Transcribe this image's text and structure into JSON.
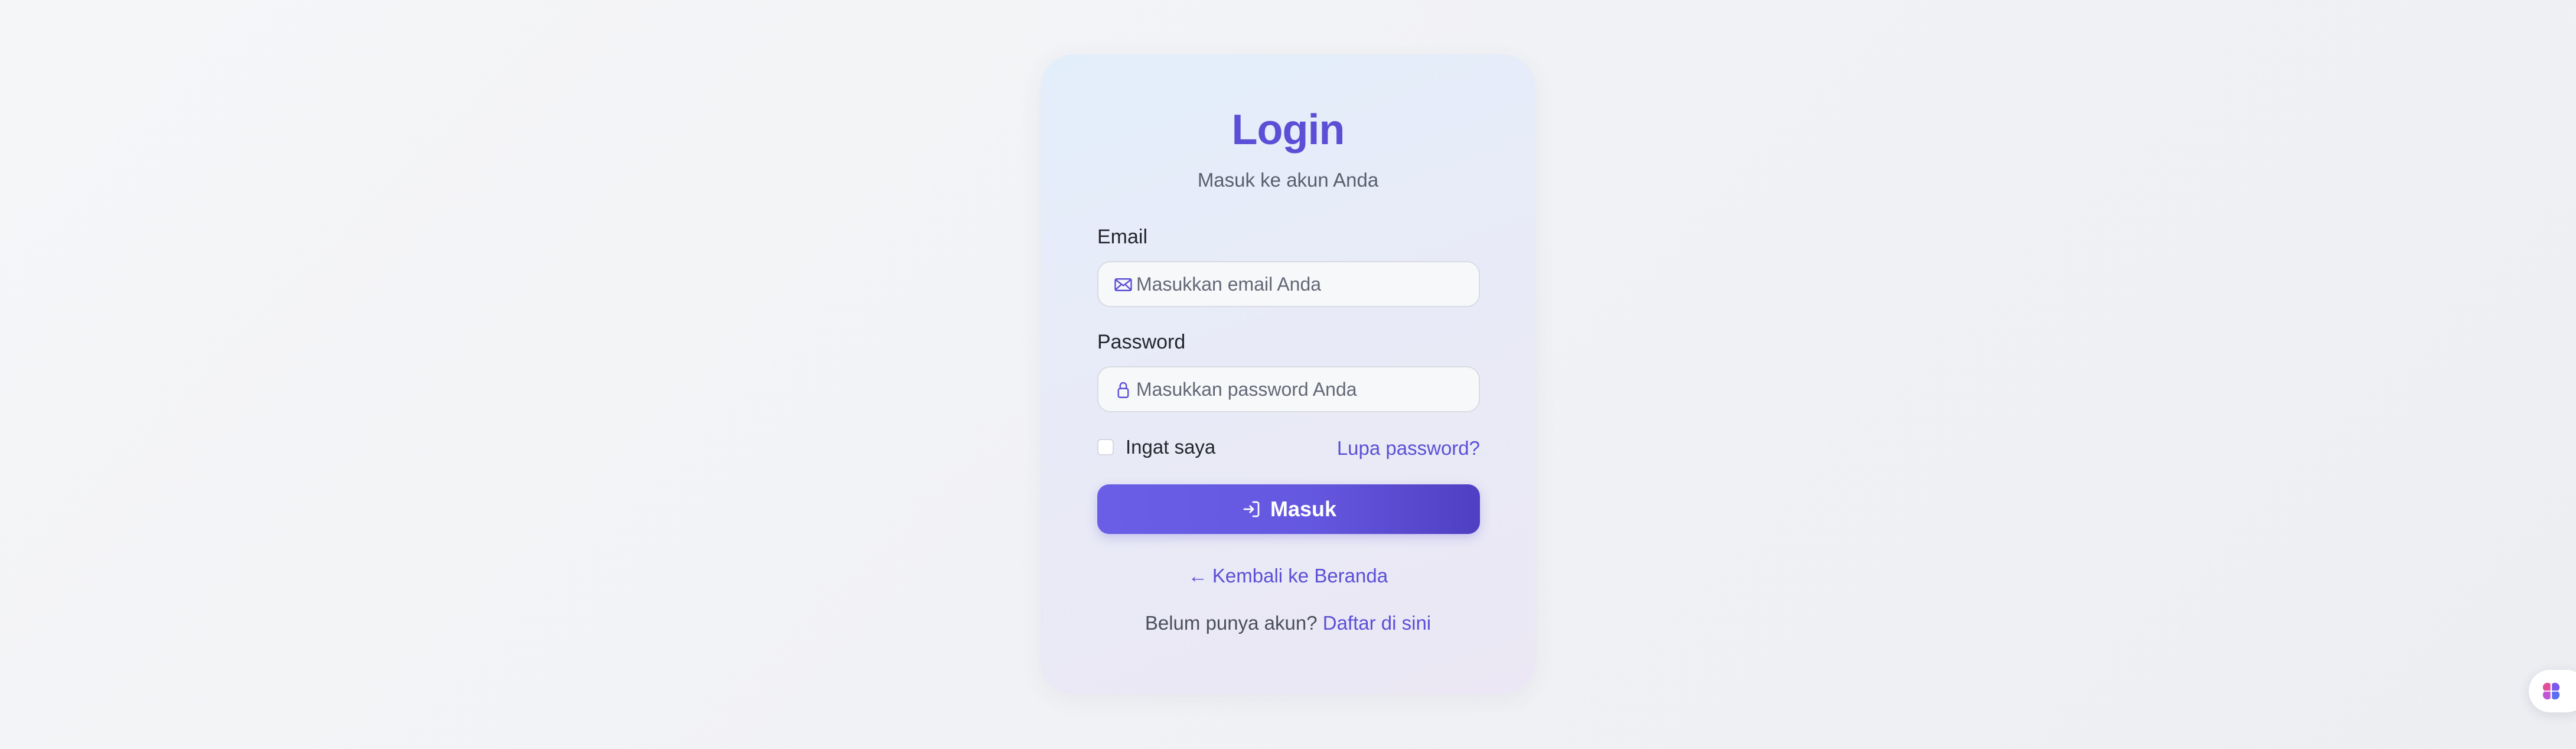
{
  "login": {
    "title": "Login",
    "subtitle": "Masuk ke akun Anda",
    "email": {
      "label": "Email",
      "placeholder": "Masukkan email Anda",
      "value": "",
      "icon": "envelope-icon"
    },
    "password": {
      "label": "Password",
      "placeholder": "Masukkan password Anda",
      "value": "",
      "icon": "lock-icon"
    },
    "remember": {
      "label": "Ingat saya",
      "checked": false
    },
    "forgot_label": "Lupa password?",
    "submit": {
      "label": "Masuk",
      "icon": "sign-in-icon"
    },
    "back": {
      "arrow": "←",
      "label": "Kembali ke Beranda"
    },
    "register": {
      "prompt": "Belum punya akun?",
      "link": "Daftar di sini"
    }
  },
  "floating_widget": {
    "icon": "brain-icon"
  },
  "colors": {
    "accent": "#5b4fd6",
    "button_start": "#6a5ee6",
    "button_end": "#4f3fc2",
    "card_background": "#e8ebf7",
    "page_background": "#f1f2f5"
  }
}
